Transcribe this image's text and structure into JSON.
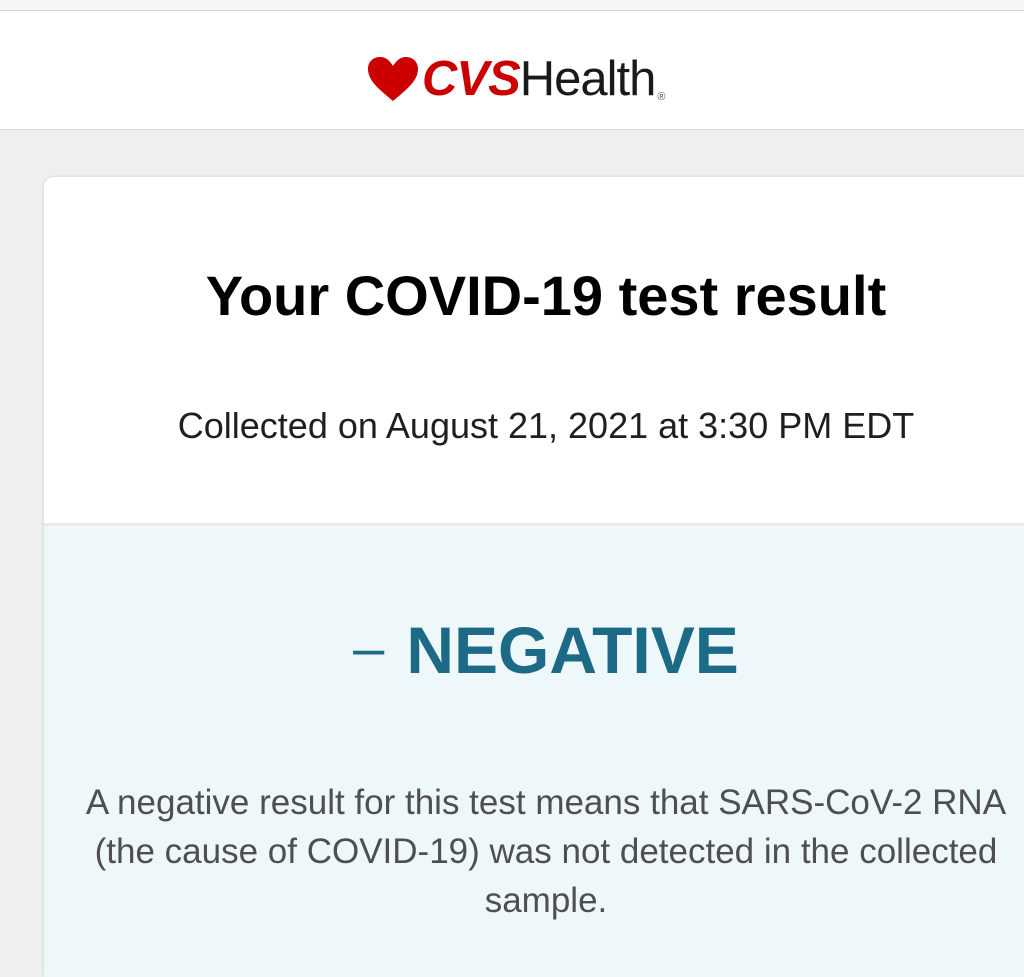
{
  "header": {
    "brand_cvs": "CVS",
    "brand_health": "Health",
    "brand_reg": "®",
    "heart_icon": "heart-icon",
    "brand_color": "#cc0000"
  },
  "card": {
    "title": "Your COVID-19 test result",
    "collected": "Collected on August 21, 2021 at 3:30 PM EDT"
  },
  "result": {
    "symbol": "–",
    "status": "NEGATIVE",
    "status_color": "#1d6a86",
    "explanation": "A negative result for this test means that SARS-CoV-2 RNA (the cause of COVID-19) was not detected in the collected sample."
  }
}
